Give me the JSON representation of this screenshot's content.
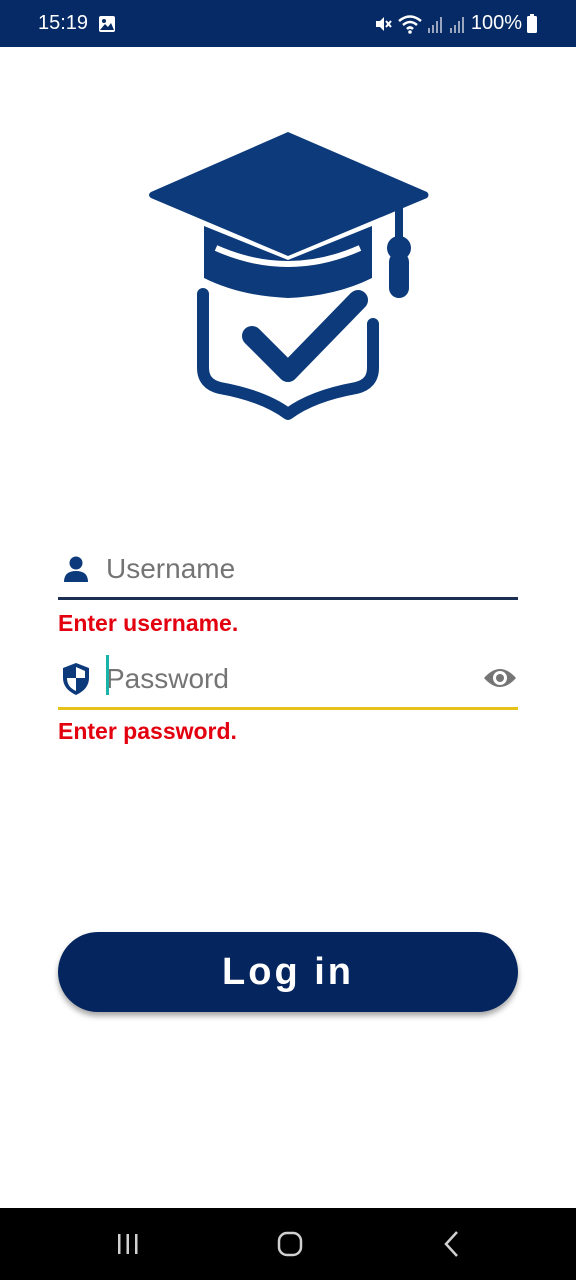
{
  "status_bar": {
    "time": "15:19",
    "battery": "100%",
    "icons": [
      "gallery-icon",
      "mute-icon",
      "wifi-icon",
      "signal-icon",
      "signal-icon",
      "battery-icon"
    ]
  },
  "logo": {
    "icon": "graduation-cap-check-icon",
    "color": "#0c3a7a"
  },
  "username": {
    "placeholder": "Username",
    "value": "",
    "icon": "person-icon",
    "error": "Enter username."
  },
  "password": {
    "placeholder": "Password",
    "value": "",
    "icon": "shield-icon",
    "toggle_icon": "eye-icon",
    "error": "Enter password."
  },
  "login_button": {
    "label": "Log in"
  },
  "nav_bar": {
    "icons": [
      "recents-icon",
      "home-icon",
      "back-icon"
    ]
  },
  "colors": {
    "primary": "#05255e",
    "error": "#e3000f",
    "focus_underline": "#e6c21a",
    "cursor": "#1bb3a8"
  }
}
